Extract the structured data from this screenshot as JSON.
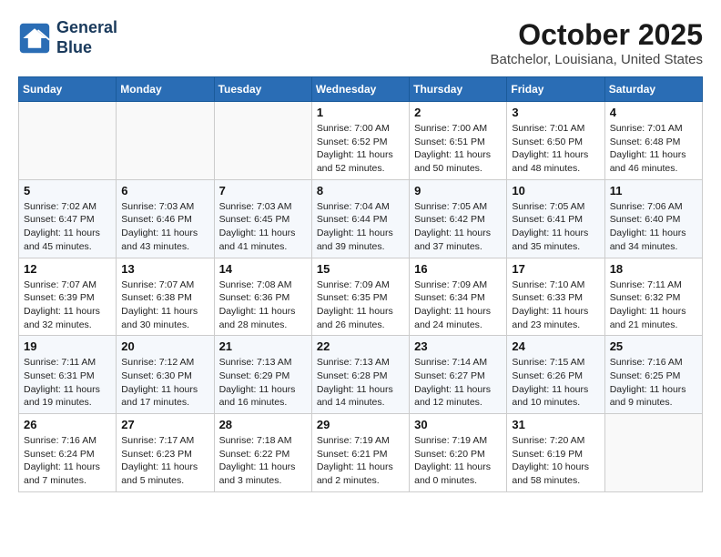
{
  "header": {
    "logo_line1": "General",
    "logo_line2": "Blue",
    "month": "October 2025",
    "location": "Batchelor, Louisiana, United States"
  },
  "days_of_week": [
    "Sunday",
    "Monday",
    "Tuesday",
    "Wednesday",
    "Thursday",
    "Friday",
    "Saturday"
  ],
  "weeks": [
    [
      {
        "day": "",
        "info": ""
      },
      {
        "day": "",
        "info": ""
      },
      {
        "day": "",
        "info": ""
      },
      {
        "day": "1",
        "info": "Sunrise: 7:00 AM\nSunset: 6:52 PM\nDaylight: 11 hours and 52 minutes."
      },
      {
        "day": "2",
        "info": "Sunrise: 7:00 AM\nSunset: 6:51 PM\nDaylight: 11 hours and 50 minutes."
      },
      {
        "day": "3",
        "info": "Sunrise: 7:01 AM\nSunset: 6:50 PM\nDaylight: 11 hours and 48 minutes."
      },
      {
        "day": "4",
        "info": "Sunrise: 7:01 AM\nSunset: 6:48 PM\nDaylight: 11 hours and 46 minutes."
      }
    ],
    [
      {
        "day": "5",
        "info": "Sunrise: 7:02 AM\nSunset: 6:47 PM\nDaylight: 11 hours and 45 minutes."
      },
      {
        "day": "6",
        "info": "Sunrise: 7:03 AM\nSunset: 6:46 PM\nDaylight: 11 hours and 43 minutes."
      },
      {
        "day": "7",
        "info": "Sunrise: 7:03 AM\nSunset: 6:45 PM\nDaylight: 11 hours and 41 minutes."
      },
      {
        "day": "8",
        "info": "Sunrise: 7:04 AM\nSunset: 6:44 PM\nDaylight: 11 hours and 39 minutes."
      },
      {
        "day": "9",
        "info": "Sunrise: 7:05 AM\nSunset: 6:42 PM\nDaylight: 11 hours and 37 minutes."
      },
      {
        "day": "10",
        "info": "Sunrise: 7:05 AM\nSunset: 6:41 PM\nDaylight: 11 hours and 35 minutes."
      },
      {
        "day": "11",
        "info": "Sunrise: 7:06 AM\nSunset: 6:40 PM\nDaylight: 11 hours and 34 minutes."
      }
    ],
    [
      {
        "day": "12",
        "info": "Sunrise: 7:07 AM\nSunset: 6:39 PM\nDaylight: 11 hours and 32 minutes."
      },
      {
        "day": "13",
        "info": "Sunrise: 7:07 AM\nSunset: 6:38 PM\nDaylight: 11 hours and 30 minutes."
      },
      {
        "day": "14",
        "info": "Sunrise: 7:08 AM\nSunset: 6:36 PM\nDaylight: 11 hours and 28 minutes."
      },
      {
        "day": "15",
        "info": "Sunrise: 7:09 AM\nSunset: 6:35 PM\nDaylight: 11 hours and 26 minutes."
      },
      {
        "day": "16",
        "info": "Sunrise: 7:09 AM\nSunset: 6:34 PM\nDaylight: 11 hours and 24 minutes."
      },
      {
        "day": "17",
        "info": "Sunrise: 7:10 AM\nSunset: 6:33 PM\nDaylight: 11 hours and 23 minutes."
      },
      {
        "day": "18",
        "info": "Sunrise: 7:11 AM\nSunset: 6:32 PM\nDaylight: 11 hours and 21 minutes."
      }
    ],
    [
      {
        "day": "19",
        "info": "Sunrise: 7:11 AM\nSunset: 6:31 PM\nDaylight: 11 hours and 19 minutes."
      },
      {
        "day": "20",
        "info": "Sunrise: 7:12 AM\nSunset: 6:30 PM\nDaylight: 11 hours and 17 minutes."
      },
      {
        "day": "21",
        "info": "Sunrise: 7:13 AM\nSunset: 6:29 PM\nDaylight: 11 hours and 16 minutes."
      },
      {
        "day": "22",
        "info": "Sunrise: 7:13 AM\nSunset: 6:28 PM\nDaylight: 11 hours and 14 minutes."
      },
      {
        "day": "23",
        "info": "Sunrise: 7:14 AM\nSunset: 6:27 PM\nDaylight: 11 hours and 12 minutes."
      },
      {
        "day": "24",
        "info": "Sunrise: 7:15 AM\nSunset: 6:26 PM\nDaylight: 11 hours and 10 minutes."
      },
      {
        "day": "25",
        "info": "Sunrise: 7:16 AM\nSunset: 6:25 PM\nDaylight: 11 hours and 9 minutes."
      }
    ],
    [
      {
        "day": "26",
        "info": "Sunrise: 7:16 AM\nSunset: 6:24 PM\nDaylight: 11 hours and 7 minutes."
      },
      {
        "day": "27",
        "info": "Sunrise: 7:17 AM\nSunset: 6:23 PM\nDaylight: 11 hours and 5 minutes."
      },
      {
        "day": "28",
        "info": "Sunrise: 7:18 AM\nSunset: 6:22 PM\nDaylight: 11 hours and 3 minutes."
      },
      {
        "day": "29",
        "info": "Sunrise: 7:19 AM\nSunset: 6:21 PM\nDaylight: 11 hours and 2 minutes."
      },
      {
        "day": "30",
        "info": "Sunrise: 7:19 AM\nSunset: 6:20 PM\nDaylight: 11 hours and 0 minutes."
      },
      {
        "day": "31",
        "info": "Sunrise: 7:20 AM\nSunset: 6:19 PM\nDaylight: 10 hours and 58 minutes."
      },
      {
        "day": "",
        "info": ""
      }
    ]
  ]
}
